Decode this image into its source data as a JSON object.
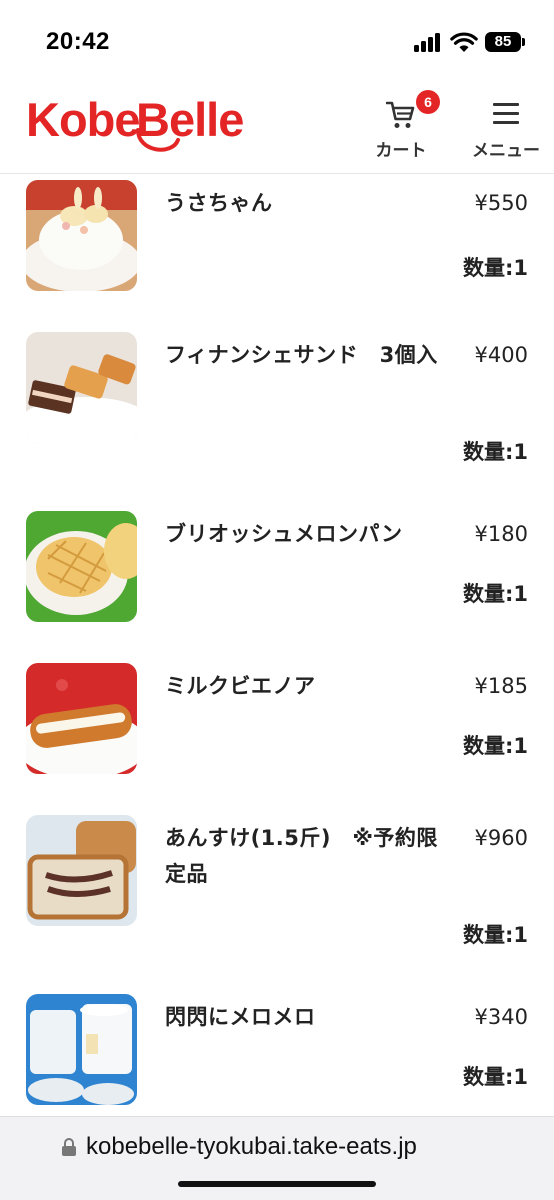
{
  "status_bar": {
    "time": "20:42",
    "battery": "85"
  },
  "header": {
    "logo_text": "KobeBelle",
    "cart_label": "カート",
    "cart_count": "6",
    "menu_label": "メニュー",
    "brand_color": "#e32526"
  },
  "products": [
    {
      "name": "うさちゃん",
      "price": "¥550",
      "quantity": "数量:1",
      "image": "rabbit-cake-image"
    },
    {
      "name": "フィナンシェサンド　3個入",
      "price": "¥400",
      "quantity": "数量:1",
      "image": "financier-sandwich-image"
    },
    {
      "name": "ブリオッシュメロンパン",
      "price": "¥180",
      "quantity": "数量:1",
      "image": "melon-bread-image"
    },
    {
      "name": "ミルクビエノア",
      "price": "¥185",
      "quantity": "数量:1",
      "image": "milk-viennois-image"
    },
    {
      "name": "あんすけ(1.5斤)　※予約限定品",
      "price": "¥960",
      "quantity": "数量:1",
      "image": "bread-loaf-image"
    },
    {
      "name": "閃閃にメロメロ",
      "price": "¥340",
      "quantity": "数量:1",
      "image": "dessert-cups-image"
    }
  ],
  "browser": {
    "url": "kobebelle-tyokubai.take-eats.jp"
  }
}
